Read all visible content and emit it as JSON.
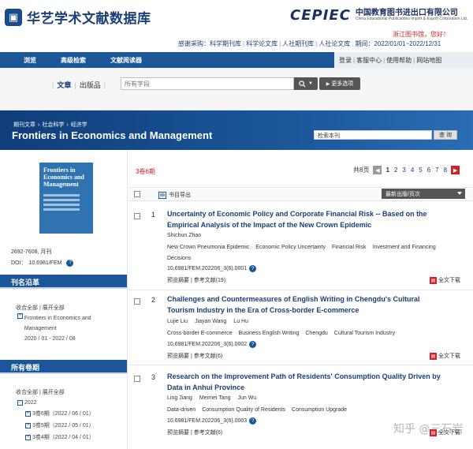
{
  "header": {
    "site_name": "华艺学术文献数据库",
    "partner_brand": "CEPIEC",
    "partner_cn": "中国教育图书进出口有限公司",
    "partner_en": "China Educational Publications Import & Export Corporation Ltd.",
    "promo": "浙江图书馆，您好！",
    "top_links": [
      "感谢采购：科学期刊库",
      "科学论文库",
      "人社期刊库",
      "人社论文库"
    ],
    "period": "期间：2022/01/01~2022/12/31"
  },
  "nav": {
    "items": [
      "浏览",
      "高级检索",
      "文献阅读器"
    ],
    "right_links": [
      "登录",
      "客服中心",
      "使用帮助",
      "网站地图"
    ]
  },
  "search": {
    "tabs": [
      "文章",
      "出版品"
    ],
    "placeholder": "所有字段",
    "more_label": "更多选项"
  },
  "banner": {
    "breadcrumb": [
      "期刊文章",
      "社会科学",
      "经济学"
    ],
    "journal_title": "Frontiers in Economics and Management",
    "search_value": "检索本刊",
    "search_btn": "查 询"
  },
  "sidebar": {
    "cover_title": "Frontiers in Economics and Management",
    "issn": "2692-7608, 月刊",
    "doi_label": "DOI：",
    "doi_value": "10.6981/FEM",
    "history_head": "刊名沿革",
    "history_toggle": "收合全部 | 展开全部",
    "history_item": "Frontiers in Economics and Management",
    "history_range": "2020 / 01 - 2022 / 08",
    "issues_head": "所有卷期",
    "issues_toggle": "收合全部 | 展开全部",
    "year": "2022",
    "issues": [
      "3卷6期（2022 / 06 / 01）",
      "3卷5期（2022 / 05 / 01）",
      "3卷4期（2022 / 04 / 01）"
    ]
  },
  "main": {
    "issue_label": "3卷6期",
    "pager": {
      "prefix": "共8页",
      "pages": [
        "1",
        "2",
        "3",
        "4",
        "5",
        "6",
        "7",
        "8"
      ]
    },
    "export_label": "书目导出",
    "sort_label": "最新出版/页次",
    "articles": [
      {
        "num": "1",
        "title": "Uncertainty of Economic Policy and Corporate Financial Risk -- Based on the Empirical Analysis of the Impact of the New Crown Epidemic",
        "authors": [
          "Shichun Zhao"
        ],
        "keywords": [
          "New Crown Pneumonia Epidemic",
          "Economic Policy Uncertainty",
          "Financial Risk",
          "Investment and Financing Decisions"
        ],
        "doi": "10.6981/FEM.202206_3(6).0001",
        "links": "预览摘要 | 参考文献(19)",
        "download": "全文下载"
      },
      {
        "num": "2",
        "title": "Challenges and Countermeasures of English Writing in Chengdu's Cultural Tourism Industry in the Era of Cross-border E-commerce",
        "authors": [
          "Lujie Liu",
          "Jiayan Wang",
          "Lu Hu"
        ],
        "keywords": [
          "Cross-border E-commerce",
          "Business English Writing",
          "Chengdu",
          "Cultural Tourism Industry"
        ],
        "doi": "10.6981/FEM.202206_3(6).0002",
        "links": "预览摘要 | 参考文献(6)",
        "download": "全文下载"
      },
      {
        "num": "3",
        "title": "Research on the Improvement Path of Residents' Consumption Quality Driven by Data in Anhui Province",
        "authors": [
          "Ling Jiang",
          "Meimei Tang",
          "Jun Wu"
        ],
        "keywords": [
          "Data-driven",
          "Consumption Quality of Residents",
          "Consumption Upgrade"
        ],
        "doi": "10.6981/FEM.202206_3(6).0003",
        "links": "预览摘要 | 参考文献(6)",
        "download": "全文下载"
      }
    ]
  },
  "watermark": "知乎 @三石岩"
}
